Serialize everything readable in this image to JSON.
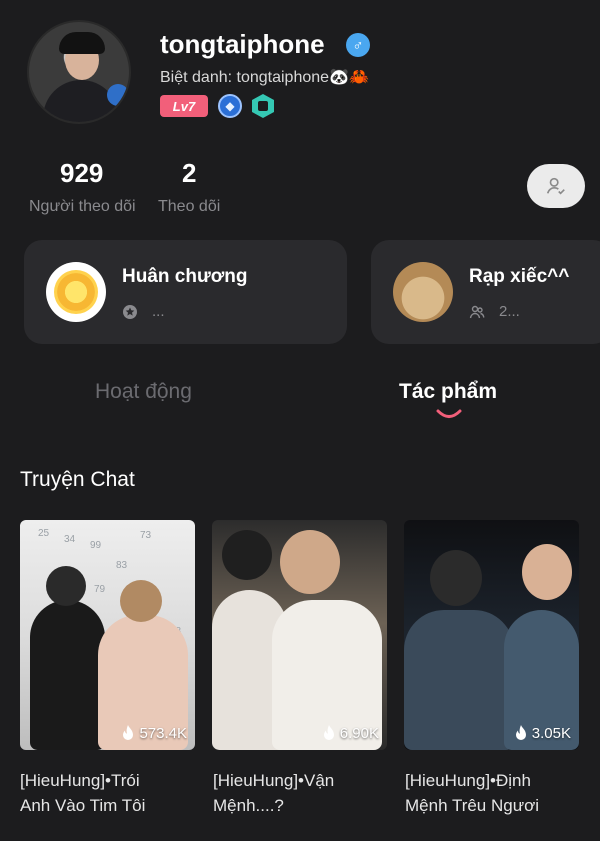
{
  "profile": {
    "username": "tongtaiphone",
    "nickname": "Biệt danh: tongtaiphone🐼🦀",
    "level": "Lv7",
    "gender_symbol": "♂"
  },
  "stats": {
    "followers": {
      "value": "929",
      "label": "Người theo dõi"
    },
    "following": {
      "value": "2",
      "label": "Theo dõi"
    }
  },
  "cards": [
    {
      "title": "Huân chương",
      "sub": "...",
      "icon": "medal-icon"
    },
    {
      "title": "Rạp xiếc^^",
      "sub": "2...",
      "icon": "cat-avatar"
    }
  ],
  "tabs": [
    {
      "label": "Hoạt động",
      "active": false
    },
    {
      "label": "Tác phẩm",
      "active": true
    }
  ],
  "section": {
    "title": "Truyện Chat"
  },
  "works": [
    {
      "views": "573.4K",
      "caption_line1": "[HieuHung]•Trói",
      "caption_line2": "Anh Vào Tim Tôi"
    },
    {
      "views": "6.90K",
      "caption_line1": "[HieuHung]•Vận",
      "caption_line2": "Mệnh....?"
    },
    {
      "views": "3.05K",
      "caption_line1": "[HieuHung]•Định",
      "caption_line2": "Mệnh Trêu Ngươi"
    }
  ],
  "colors": {
    "background": "#1c1c1e",
    "card": "#2a2a2d",
    "accent": "#f25f7a",
    "muted": "#8a8a8e"
  }
}
